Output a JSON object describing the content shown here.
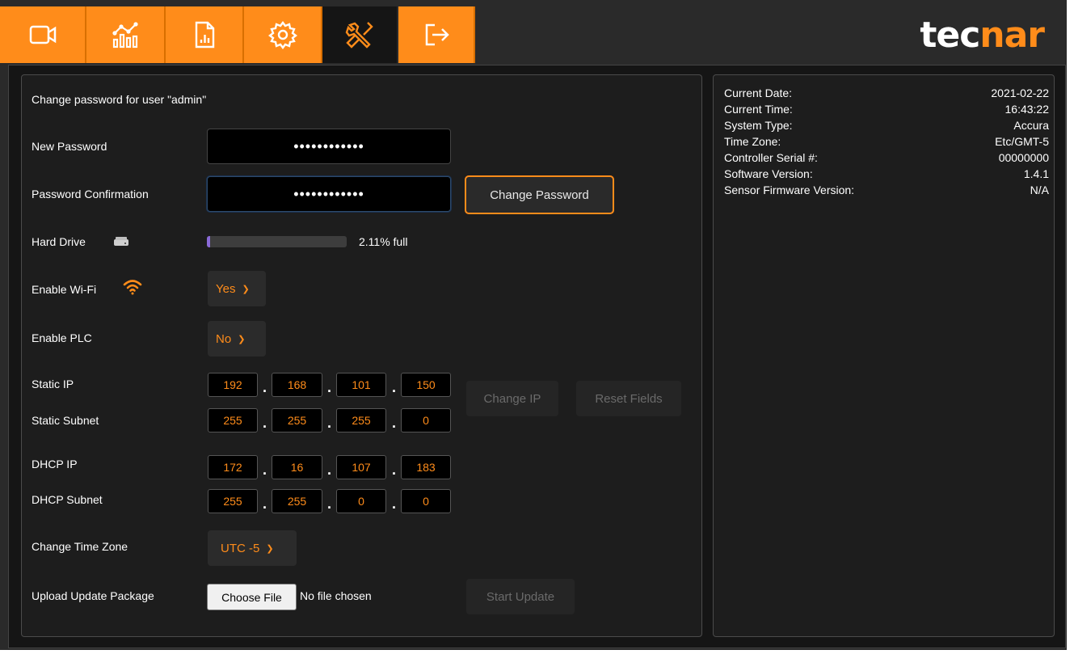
{
  "colors": {
    "accent": "#ff8c1a",
    "background": "#1d1d1d",
    "progress_fill": "#8a6ad8"
  },
  "nav": {
    "tabs": [
      {
        "icon": "video-camera-icon"
      },
      {
        "icon": "chart-analytics-icon"
      },
      {
        "icon": "report-document-icon"
      },
      {
        "icon": "gear-icon"
      },
      {
        "icon": "tools-icon",
        "active": true
      },
      {
        "icon": "logout-icon"
      }
    ],
    "logo_part1": "tec",
    "logo_accent": "nar"
  },
  "form": {
    "heading": "Change password for user \"admin\"",
    "new_password_label": "New Password",
    "new_password_value": "••••••••••••",
    "confirm_label": "Password Confirmation",
    "confirm_value": "••••••••••••",
    "change_password_button": "Change Password",
    "hard_drive_label": "Hard Drive",
    "hard_drive_percent": 2.11,
    "hard_drive_text": "2.11% full",
    "wifi_label": "Enable Wi-Fi",
    "wifi_value": "Yes",
    "plc_label": "Enable PLC",
    "plc_value": "No",
    "static_ip_label": "Static IP",
    "static_ip": [
      "192",
      "168",
      "101",
      "150"
    ],
    "static_subnet_label": "Static Subnet",
    "static_subnet": [
      "255",
      "255",
      "255",
      "0"
    ],
    "change_ip_button": "Change IP",
    "reset_fields_button": "Reset Fields",
    "dhcp_ip_label": "DHCP IP",
    "dhcp_ip": [
      "172",
      "16",
      "107",
      "183"
    ],
    "dhcp_subnet_label": "DHCP Subnet",
    "dhcp_subnet": [
      "255",
      "255",
      "0",
      "0"
    ],
    "timezone_label": "Change Time Zone",
    "timezone_value": "UTC -5",
    "upload_label": "Upload Update Package",
    "choose_file_button": "Choose File",
    "no_file_text": "No file chosen",
    "start_update_button": "Start Update"
  },
  "info": {
    "rows": [
      {
        "key": "Current Date:",
        "value": "2021-02-22"
      },
      {
        "key": "Current Time:",
        "value": "16:43:22"
      },
      {
        "key": "System Type:",
        "value": "Accura"
      },
      {
        "key": "Time Zone:",
        "value": "Etc/GMT-5"
      },
      {
        "key": "Controller Serial #:",
        "value": "00000000"
      },
      {
        "key": "Software Version:",
        "value": "1.4.1"
      },
      {
        "key": "Sensor Firmware Version:",
        "value": "N/A"
      }
    ]
  }
}
